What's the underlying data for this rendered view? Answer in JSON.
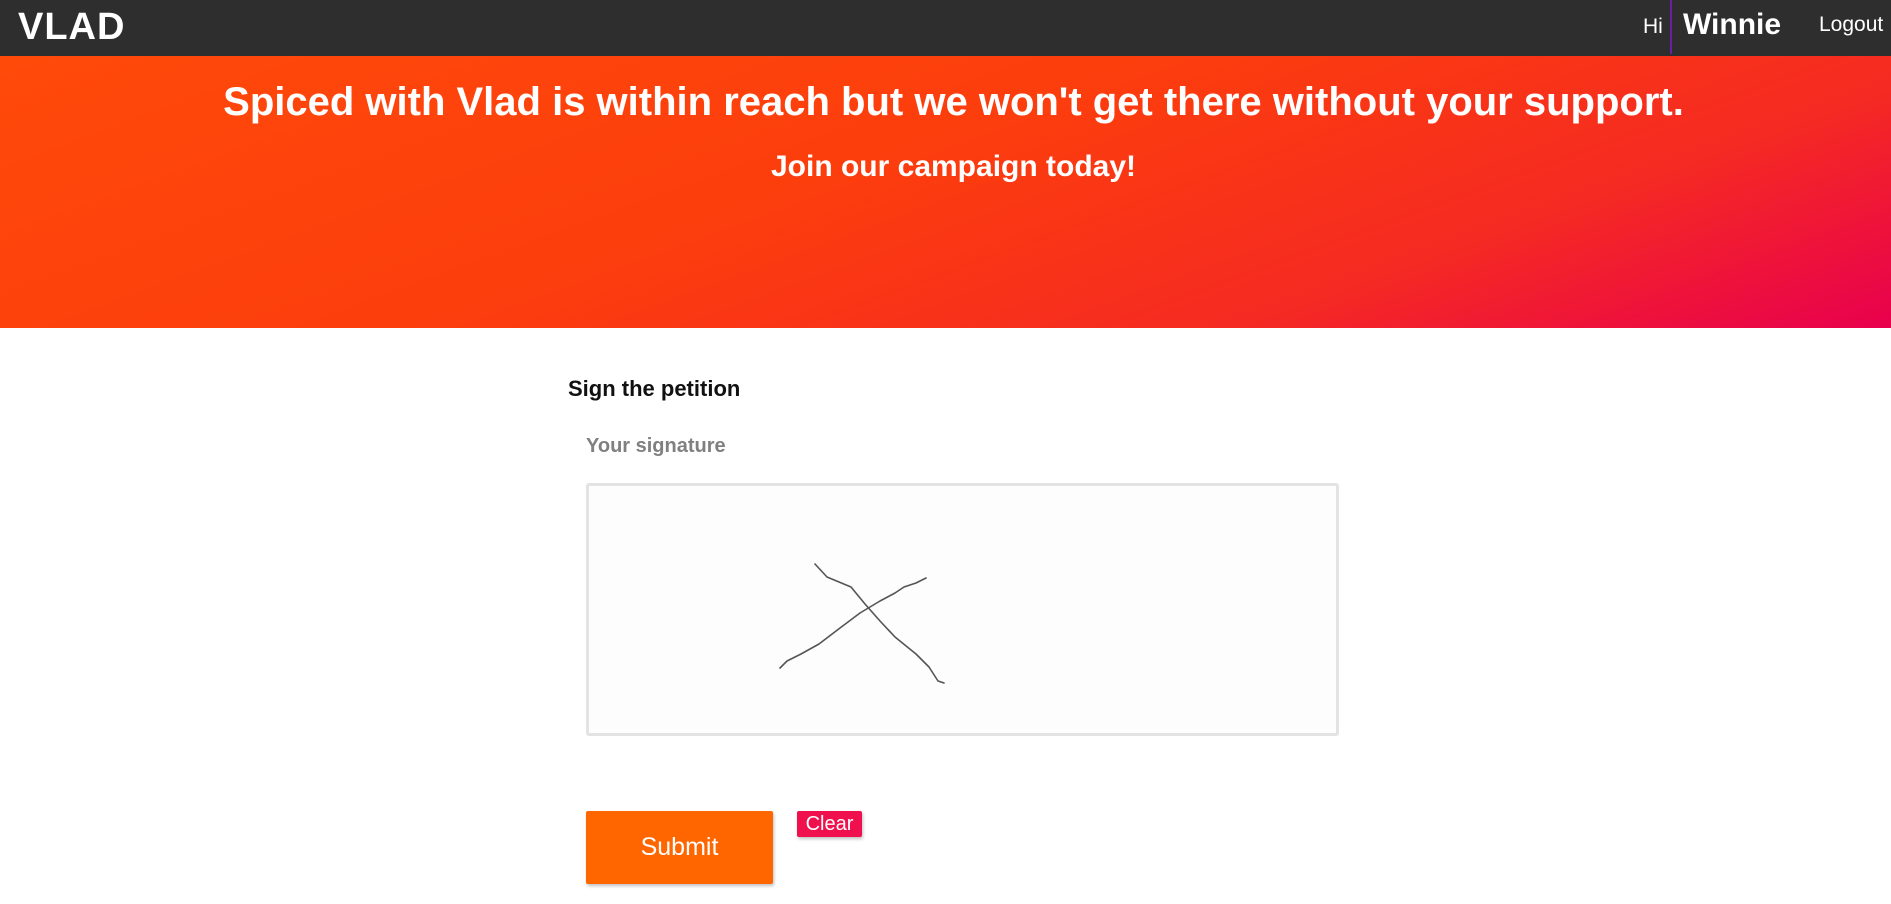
{
  "header": {
    "logo_text": "VLAD",
    "greeting": "Hi",
    "username": "Winnie",
    "logout_label": "Logout"
  },
  "hero": {
    "title": "Spiced with Vlad is within reach but we won't get there without your support.",
    "subtitle": "Join our campaign today!"
  },
  "petition": {
    "heading": "Sign the petition",
    "signature_label": "Your signature",
    "signature_drawn": true,
    "submit_label": "Submit",
    "clear_label": "Clear"
  },
  "colors": {
    "topbar": "#2e2e2e",
    "hero_gradient_start": "#ff4a0a",
    "hero_gradient_end": "#e8004e",
    "submit_button": "#ff6600",
    "clear_button": "#f0104e",
    "user_divider": "#6a1fa0"
  }
}
